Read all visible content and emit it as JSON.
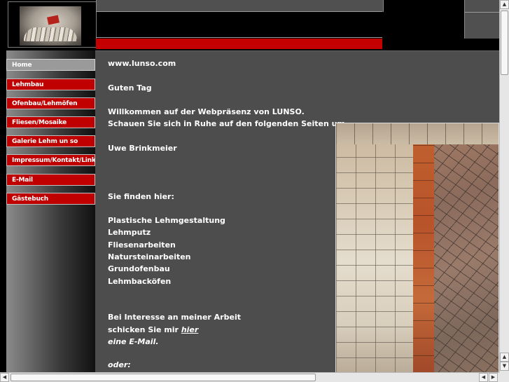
{
  "nav": {
    "items": [
      {
        "label": "Home",
        "active": true
      },
      {
        "label": "Lehmbau",
        "active": false
      },
      {
        "label": "Ofenbau/Lehmöfen",
        "active": false
      },
      {
        "label": "Fliesen/Mosaike",
        "active": false
      },
      {
        "label": "Galerie Lehm un so",
        "active": false
      },
      {
        "label": "Impressum/Kontakt/Links",
        "active": false
      },
      {
        "label": "E-Mail",
        "active": false
      },
      {
        "label": "Gästebuch",
        "active": false
      }
    ]
  },
  "content": {
    "site_url": "www.lunso.com",
    "greeting": "Guten Tag",
    "welcome_line1": "Willkommen auf der Webpräsenz von LUNSO.",
    "welcome_line2": "Schauen Sie sich in Ruhe auf den folgenden Seiten um.",
    "author": "Uwe Brinkmeier",
    "services_intro": "Sie finden hier:",
    "services": [
      "Plastische Lehmgestaltung",
      "Lehmputz",
      "Fliesenarbeiten",
      "Natursteinarbeiten",
      "Grundofenbau",
      "Lehmbacköfen"
    ],
    "interest_line1": "Bei Interesse an meiner Arbeit",
    "interest_line2_prefix": "schicken Sie mir",
    "interest_link": "hier",
    "interest_line3": "eine E-Mail.",
    "or_label": "oder:"
  },
  "colors": {
    "nav_red": "#c00000",
    "header_red": "#c40000",
    "content_bg": "#4d4d4d",
    "text": "#ffffff"
  },
  "icons": {
    "scroll_up": "▲",
    "scroll_down": "▼",
    "scroll_left": "◀",
    "scroll_right": "▶"
  }
}
